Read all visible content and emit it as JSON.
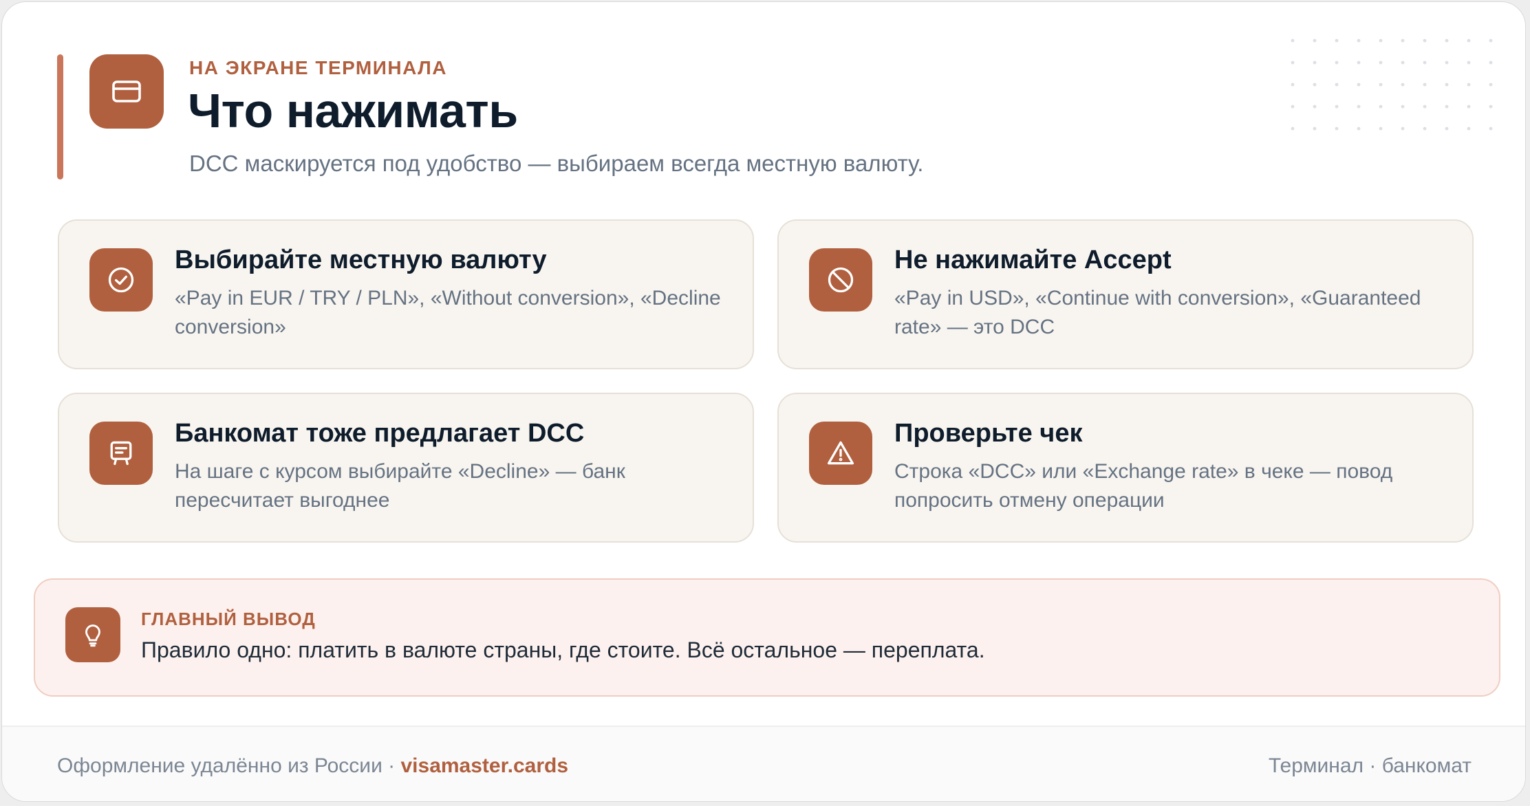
{
  "header": {
    "eyebrow": "НА ЭКРАНЕ ТЕРМИНАЛА",
    "title": "Что нажимать",
    "subtitle": "DCC маскируется под удобство — выбираем всегда местную валюту.",
    "icon": "credit-card-icon"
  },
  "cards": [
    {
      "icon": "check-circle-icon",
      "title": "Выбирайте местную валюту",
      "text": "«Pay in EUR / TRY / PLN», «Without conversion», «Decline conversion»"
    },
    {
      "icon": "ban-icon",
      "title": "Не нажимайте Accept",
      "text": "«Pay in USD», «Continue with conversion», «Guaranteed rate» — это DCC"
    },
    {
      "icon": "atm-icon",
      "title": "Банкомат тоже предлагает DCC",
      "text": "На шаге с курсом выбирайте «Decline» — банк пересчитает выгоднее"
    },
    {
      "icon": "warning-icon",
      "title": "Проверьте чек",
      "text": "Строка «DCC» или «Exchange rate» в чеке — повод попросить отмену операции"
    }
  ],
  "callout": {
    "icon": "lightbulb-icon",
    "label": "ГЛАВНЫЙ ВЫВОД",
    "text": "Правило одно: платить в валюте страны, где стоите. Всё остальное — переплата."
  },
  "footer": {
    "left_text": "Оформление удалённо из России · ",
    "brand": "visamaster.cards",
    "right_text": "Терминал · банкомат"
  },
  "colors": {
    "accent": "#b0603f",
    "accent_bar": "#c9765a",
    "title": "#0e1c2b",
    "muted": "#657282",
    "card_bg": "#f8f5f0",
    "callout_bg": "#fcf1ee"
  }
}
